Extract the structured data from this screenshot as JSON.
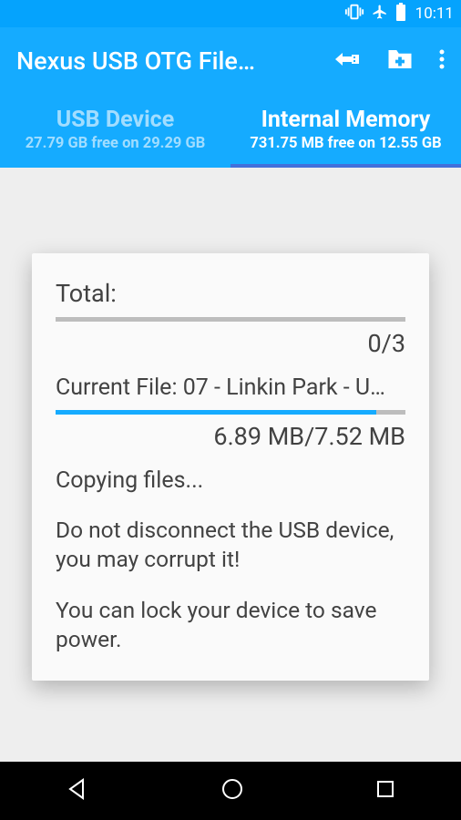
{
  "statusbar": {
    "time": "10:11"
  },
  "appbar": {
    "title": "Nexus USB OTG File…"
  },
  "tabs": {
    "usb": {
      "label": "USB Device",
      "sub": "27.79 GB free on 29.29 GB"
    },
    "internal": {
      "label": "Internal Memory",
      "sub": "731.75 MB free on 12.55 GB"
    }
  },
  "dialog": {
    "total_label": "Total:",
    "total_value": "0/3",
    "current_label": "Current File: 07 - Linkin Park - U…",
    "current_value": "6.89 MB/7.52 MB",
    "status": "Copying files...",
    "warning": "Do not disconnect the USB device, you may corrupt it!",
    "hint": "You can lock your device to save power."
  }
}
